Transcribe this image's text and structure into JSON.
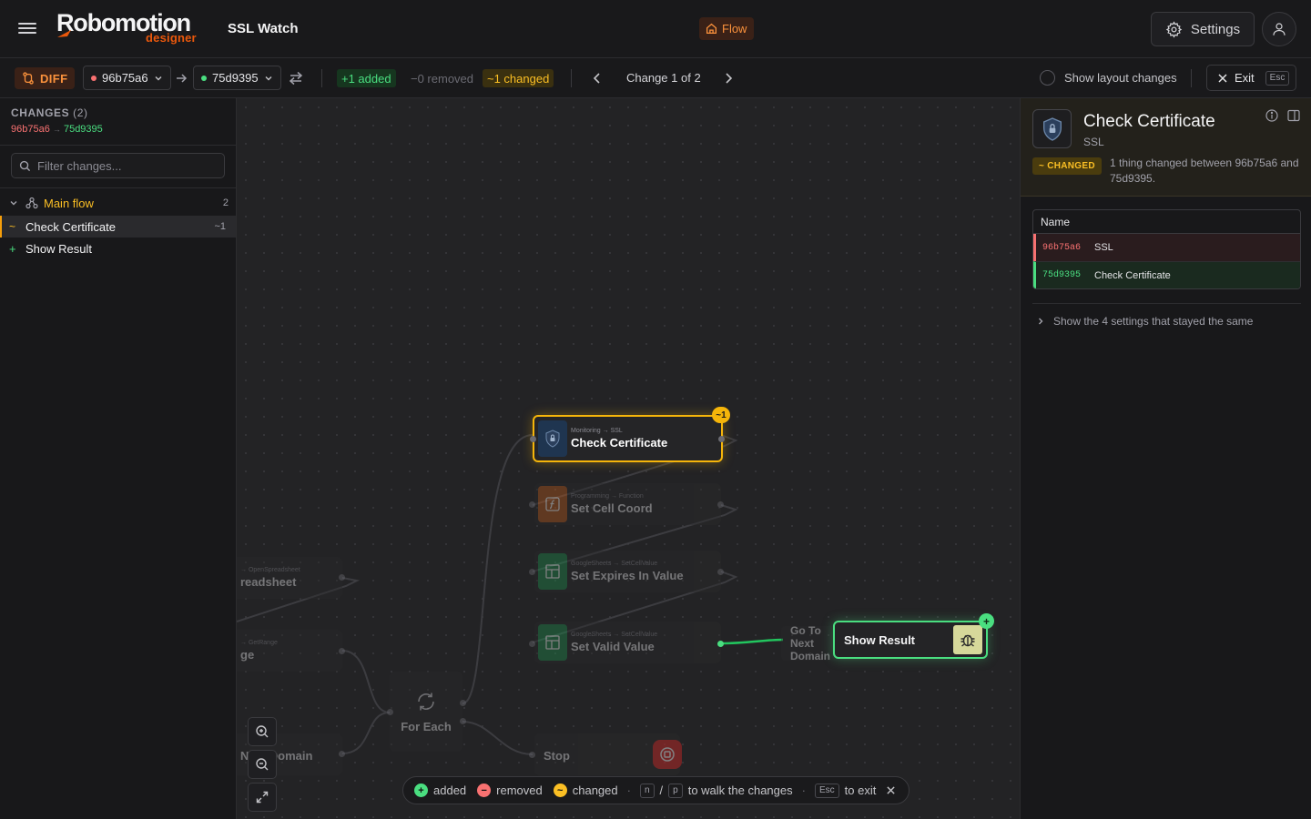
{
  "app": {
    "logo_main": "Robomotion",
    "logo_sub": "designer",
    "project_title": "SSL Watch",
    "flow_chip": "Flow",
    "settings_label": "Settings"
  },
  "diffbar": {
    "diff_label": "DIFF",
    "from_rev": "96b75a6",
    "to_rev": "75d9395",
    "added": "+1 added",
    "removed": "−0 removed",
    "changed": "~1 changed",
    "counter": "Change 1 of 2",
    "layout_toggle": "Show layout changes",
    "exit_label": "Exit",
    "exit_key": "Esc"
  },
  "changes_panel": {
    "title": "CHANGES",
    "count": "(2)",
    "from_rev": "96b75a6",
    "arrow": "→",
    "to_rev": "75d9395",
    "filter_placeholder": "Filter changes...",
    "group": {
      "label": "Main flow",
      "count": "2"
    },
    "items": [
      {
        "marker": "~",
        "label": "Check Certificate",
        "count": "~1",
        "status": "changed"
      },
      {
        "marker": "+",
        "label": "Show Result",
        "count": "",
        "status": "added"
      }
    ]
  },
  "canvas": {
    "nodes": {
      "check_cert": {
        "crumb": "Monitoring → SSL",
        "name": "Check Certificate",
        "badge": "~1"
      },
      "set_cell": {
        "crumb": "Programming → Function",
        "name": "Set Cell Coord"
      },
      "set_expires": {
        "crumb": "GoogleSheets → SetCellValue",
        "name": "Set Expires In Value"
      },
      "set_valid": {
        "crumb": "GoogleSheets → SetCellValue",
        "name": "Set Valid Value"
      },
      "open_sheet": {
        "crumb": "→ OpenSpreadsheet",
        "name": "readsheet"
      },
      "get_range": {
        "crumb": "→ GetRange",
        "name": "ge"
      },
      "next_domain": {
        "name": "Next Domain"
      },
      "for_each": {
        "name": "For Each"
      },
      "stop": {
        "name": "Stop"
      },
      "goto_next": {
        "name": "Go To Next Domain"
      },
      "show_result": {
        "name": "Show Result",
        "badge": "+"
      }
    },
    "legend": {
      "added": "added",
      "removed": "removed",
      "changed": "changed",
      "key_n": "n",
      "slash": "/",
      "key_p": "p",
      "walk": "to walk the changes",
      "key_esc": "Esc",
      "exit": "to exit"
    }
  },
  "inspector": {
    "title": "Check Certificate",
    "subtitle": "SSL",
    "badge": "~ CHANGED",
    "description": "1 thing changed between 96b75a6 and 75d9395.",
    "table_header": "Name",
    "rows": [
      {
        "rev": "96b75a6",
        "value": "SSL",
        "kind": "old"
      },
      {
        "rev": "75d9395",
        "value": "Check Certificate",
        "kind": "new"
      }
    ],
    "same_settings": "Show the 4 settings that stayed the same"
  },
  "colors": {
    "accent": "#ea580c",
    "added": "#4ade80",
    "removed": "#f87171",
    "changed": "#fbbf24"
  }
}
